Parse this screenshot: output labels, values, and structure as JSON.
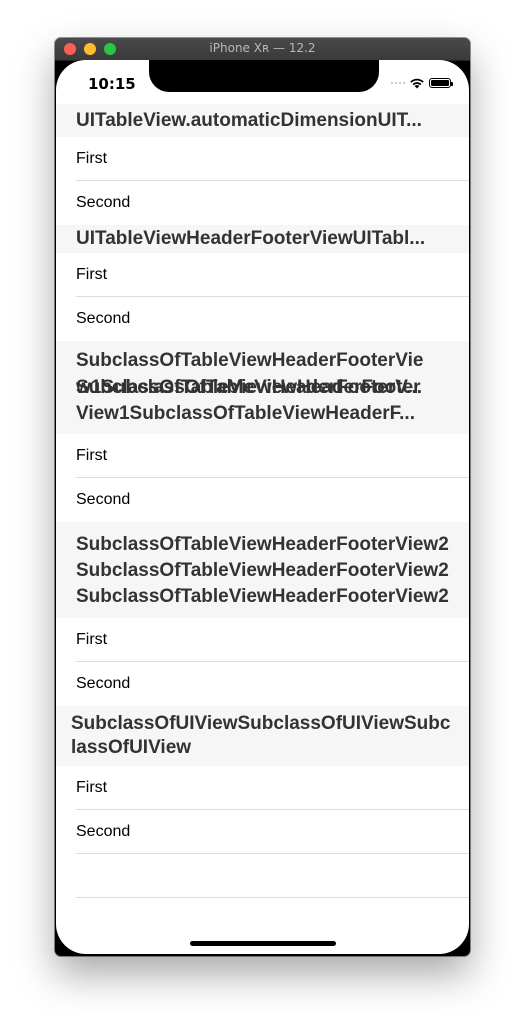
{
  "window": {
    "title": "iPhone Xʀ — 12.2"
  },
  "status_bar": {
    "time": "10:15"
  },
  "sections": [
    {
      "header": "UITableView.automaticDimensionUIT...",
      "rows": [
        "First",
        "Second"
      ]
    },
    {
      "header": "UITableViewHeaderFooterViewUITabl...",
      "rows": [
        "First",
        "Second"
      ]
    },
    {
      "header_line1": "SubclassOfTableViewHeaderFooterVie",
      "header_line2a": "w1SubclassOfTableViewHeaderFooter",
      "header_line2b": "SubclassOfTableViewHeaderFooterV...",
      "header_line3": "View1SubclassOfTableViewHeaderF...",
      "rows": [
        "First",
        "Second"
      ]
    },
    {
      "header": "SubclassOfTableViewHeaderFooterView2SubclassOfTableViewHeaderFooterView2SubclassOfTableViewHeaderFooterView2",
      "rows": [
        "First",
        "Second"
      ]
    },
    {
      "header": "SubclassOfUIViewSubclassOfUIViewSubclassOfUIView",
      "rows": [
        "First",
        "Second"
      ]
    }
  ]
}
